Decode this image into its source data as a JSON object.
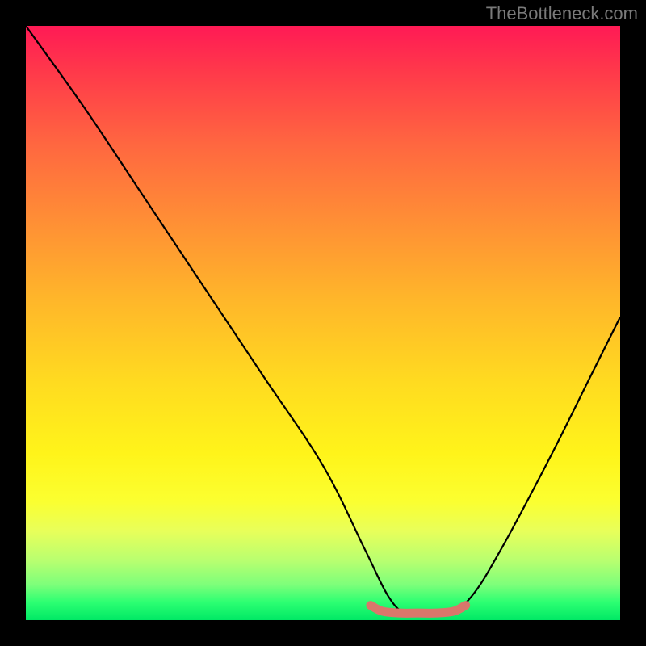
{
  "attribution": "TheBottleneck.com",
  "chart_data": {
    "type": "line",
    "title": "",
    "xlabel": "",
    "ylabel": "",
    "xlim": [
      0,
      100
    ],
    "ylim": [
      0,
      100
    ],
    "series": [
      {
        "name": "bottleneck-curve",
        "x": [
          0,
          10,
          20,
          30,
          40,
          50,
          57,
          61,
          64,
          67,
          71,
          75,
          80,
          88,
          95,
          100
        ],
        "values": [
          100,
          86,
          71,
          56,
          41,
          26,
          12,
          4,
          1,
          1,
          1,
          4,
          12,
          27,
          41,
          51
        ]
      },
      {
        "name": "optimal-band",
        "x": [
          58,
          60,
          63,
          66,
          69,
          72,
          74
        ],
        "values": [
          2.5,
          1.5,
          1.2,
          1.2,
          1.2,
          1.5,
          2.5
        ]
      }
    ],
    "colors": {
      "curve": "#000000",
      "optimal_band": "#d9776b",
      "gradient_top": "#ff1a55",
      "gradient_bottom": "#00e865"
    }
  }
}
